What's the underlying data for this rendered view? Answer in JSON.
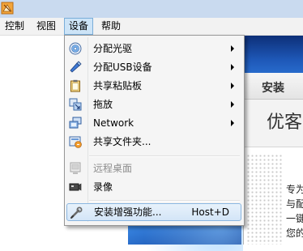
{
  "menubar": {
    "items": [
      {
        "label": "控制"
      },
      {
        "label": "视图"
      },
      {
        "label": "设备"
      },
      {
        "label": "帮助"
      }
    ]
  },
  "devices_menu": {
    "items": [
      {
        "label": "分配光驱",
        "icon": "optical-disc-icon",
        "submenu": true
      },
      {
        "label": "分配USB设备",
        "icon": "usb-pen-icon",
        "submenu": true
      },
      {
        "label": "共享粘贴板",
        "icon": "clipboard-icon",
        "submenu": true
      },
      {
        "label": "拖放",
        "icon": "drag-drop-icon",
        "submenu": true
      },
      {
        "label": "Network",
        "icon": "network-icon",
        "submenu": true
      },
      {
        "label": "共享文件夹...",
        "icon": "shared-folder-icon",
        "submenu": false
      },
      {
        "label": "远程桌面",
        "icon": "remote-desktop-icon",
        "disabled": true
      },
      {
        "label": "录像",
        "icon": "video-capture-icon"
      },
      {
        "label": "安装增强功能...",
        "icon": "guest-additions-icon",
        "shortcut": "Host+D",
        "selected": true
      }
    ]
  },
  "guest": {
    "installer_tab": "安装",
    "installer_heading": "优客",
    "installer_lines": [
      "专为",
      "与配",
      "一键",
      "您的"
    ]
  },
  "colors": {
    "menu_highlight": "#d3e5f7",
    "menubar_active": "#cde4f7",
    "desktop_blue": "#1552c4"
  }
}
